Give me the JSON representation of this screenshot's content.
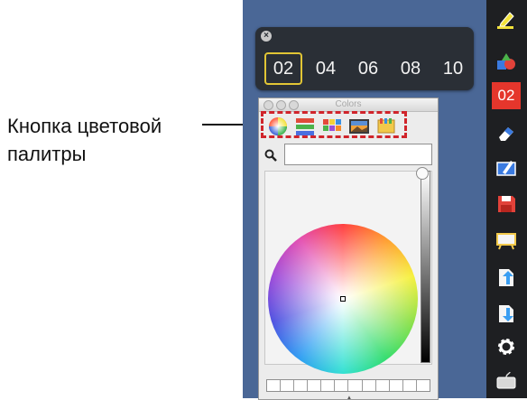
{
  "callout": {
    "line1": "Кнопка цветовой",
    "line2": "палитры"
  },
  "pen_panel": {
    "close_symbol": "×",
    "sizes": [
      "02",
      "04",
      "06",
      "08",
      "10"
    ],
    "selected": "02"
  },
  "colors_window": {
    "title": "Colors",
    "tabs": [
      "color-wheel",
      "color-sliders",
      "color-palettes",
      "image-palettes",
      "crayons"
    ],
    "search_value": "",
    "swatch_count": 12
  },
  "toolbar": {
    "items": [
      "highlighter-icon",
      "shapes-icon",
      "pen-size",
      "eraser-icon",
      "screen-draw-icon",
      "save-icon",
      "whiteboard-icon",
      "export-icon",
      "import-icon",
      "settings-icon",
      "keyboard-icon"
    ],
    "pen_size_label": "02"
  },
  "colors": {
    "toolbar_bg": "#1e1f22",
    "desktop_bg": "#4a6796",
    "active_red": "#e5362c",
    "highlight_border": "#d0242b",
    "selected_border": "#e1c535"
  }
}
